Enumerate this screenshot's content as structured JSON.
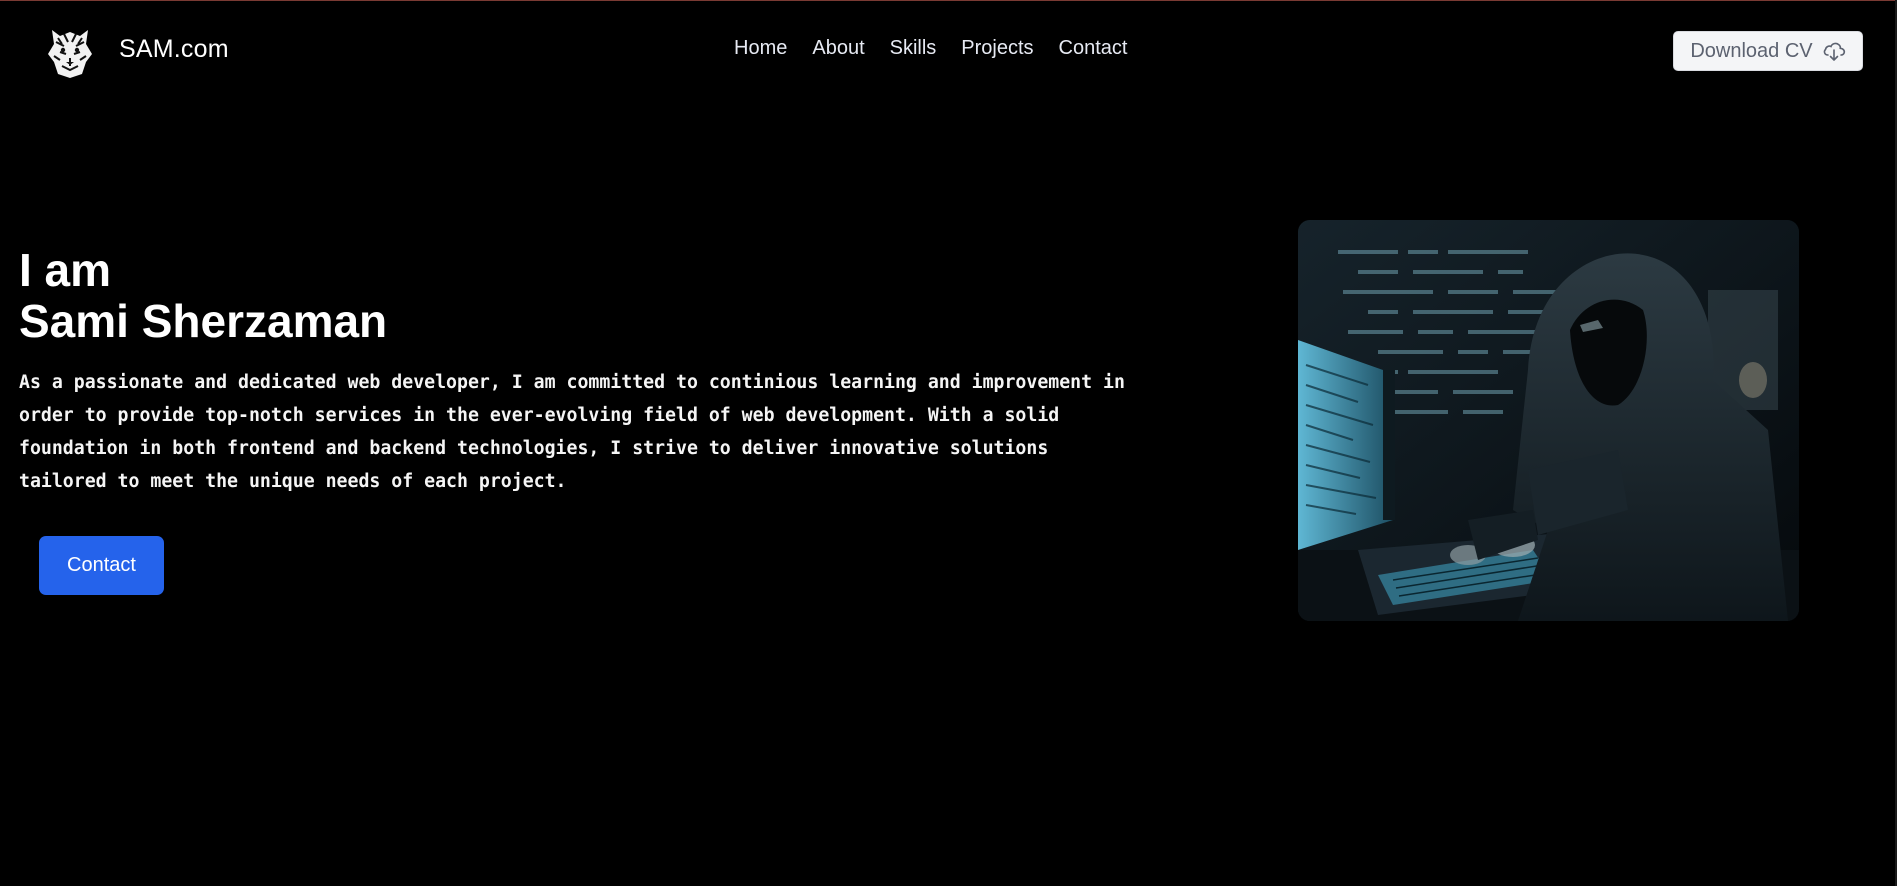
{
  "header": {
    "brand": "SAM.com",
    "logo_icon": "tiger-head-icon",
    "nav": [
      "Home",
      "About",
      "Skills",
      "Projects",
      "Contact"
    ],
    "cv_button": "Download CV",
    "cv_icon": "cloud-download-icon"
  },
  "hero": {
    "title_line1": "I am",
    "title_line2": "Sami Sherzaman",
    "description": "As a passionate and dedicated web developer, I am committed to continious learning and improvement in order to provide top-notch services in the ever-evolving field of web development. With a solid foundation in both frontend and backend technologies, I strive to deliver innovative solutions tailored to meet the unique needs of each project.",
    "contact_button": "Contact",
    "image_icon": "hooded-hacker-at-computer-image"
  },
  "colors": {
    "background": "#000000",
    "accent": "#2563eb",
    "cv_button_bg": "#f4f5f7"
  }
}
